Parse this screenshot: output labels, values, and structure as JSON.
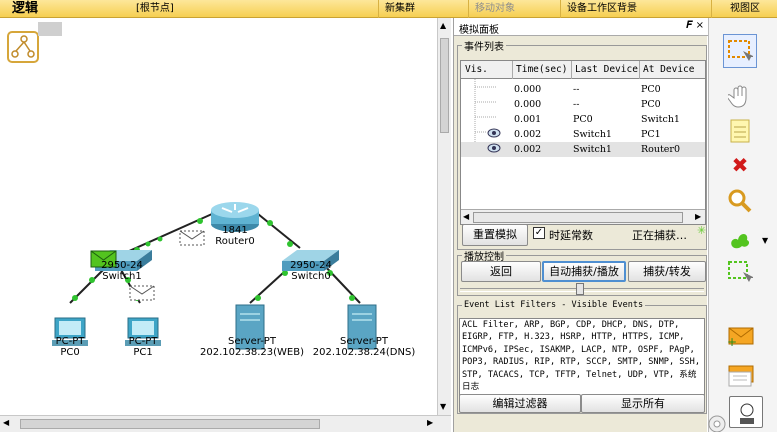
{
  "topbar": {
    "logic_label": "逻辑",
    "root_label": "[根节点]",
    "new_cluster": "新集群",
    "move_object": "移动对象",
    "set_tiled_bg": "设备工作区背景",
    "viewport": "视图区"
  },
  "devices": {
    "router0": {
      "model": "1841",
      "name": "Router0"
    },
    "switch1": {
      "model": "2950-24",
      "name": "Switch1"
    },
    "switch0": {
      "model": "2950-24",
      "name": "Switch0"
    },
    "pc0": {
      "model": "PC-PT",
      "name": "PC0"
    },
    "pc1": {
      "model": "PC-PT",
      "name": "PC1"
    },
    "server_web": {
      "model": "Server-PT",
      "name": "202.102.38.23(WEB)"
    },
    "server_dns": {
      "model": "Server-PT",
      "name": "202.102.38.24(DNS)"
    }
  },
  "sim_panel": {
    "title": "模拟面板",
    "controls": "𝑭 ×",
    "event_list_legend": "事件列表",
    "columns": [
      "Vis.",
      "Time(sec)",
      "Last Device",
      "At Device"
    ],
    "events": [
      {
        "time": "0.000",
        "last": "--",
        "at": "PC0"
      },
      {
        "time": "0.000",
        "last": "--",
        "at": "PC0"
      },
      {
        "time": "0.001",
        "last": "PC0",
        "at": "Switch1"
      },
      {
        "time": "0.002",
        "last": "Switch1",
        "at": "PC1"
      },
      {
        "time": "0.002",
        "last": "Switch1",
        "at": "Router0"
      }
    ],
    "reset_button": "重置模拟",
    "constant_delay_label": "时延常数",
    "constant_delay_checked": true,
    "capturing_text": "正在捕获…",
    "play_legend": "播放控制",
    "back_button": "返回",
    "auto_capture_button": "自动捕获/播放",
    "capture_forward_button": "捕获/转发",
    "filters_legend": "Event List Filters - Visible Events",
    "filters_text": "ACL Filter, ARP, BGP, CDP, DHCP, DNS, DTP, EIGRP, FTP, H.323, HSRP, HTTP, HTTPS, ICMP, ICMPv6, IPSec, ISAKMP, LACP, NTP, OSPF, PAgP, POP3, RADIUS, RIP, RTP, SCCP, SMTP, SNMP, SSH, STP, TACACS, TCP, TFTP, Telnet, UDP, VTP, 系统日志",
    "edit_filters_button": "编辑过滤器",
    "show_all_button": "显示所有"
  },
  "toolbar_icons": [
    "select-icon",
    "hand-icon",
    "note-icon",
    "delete-icon",
    "zoom-icon",
    "draw-shape-icon",
    "resize-icon",
    "add-simple-pdu-icon",
    "add-complex-pdu-icon"
  ]
}
